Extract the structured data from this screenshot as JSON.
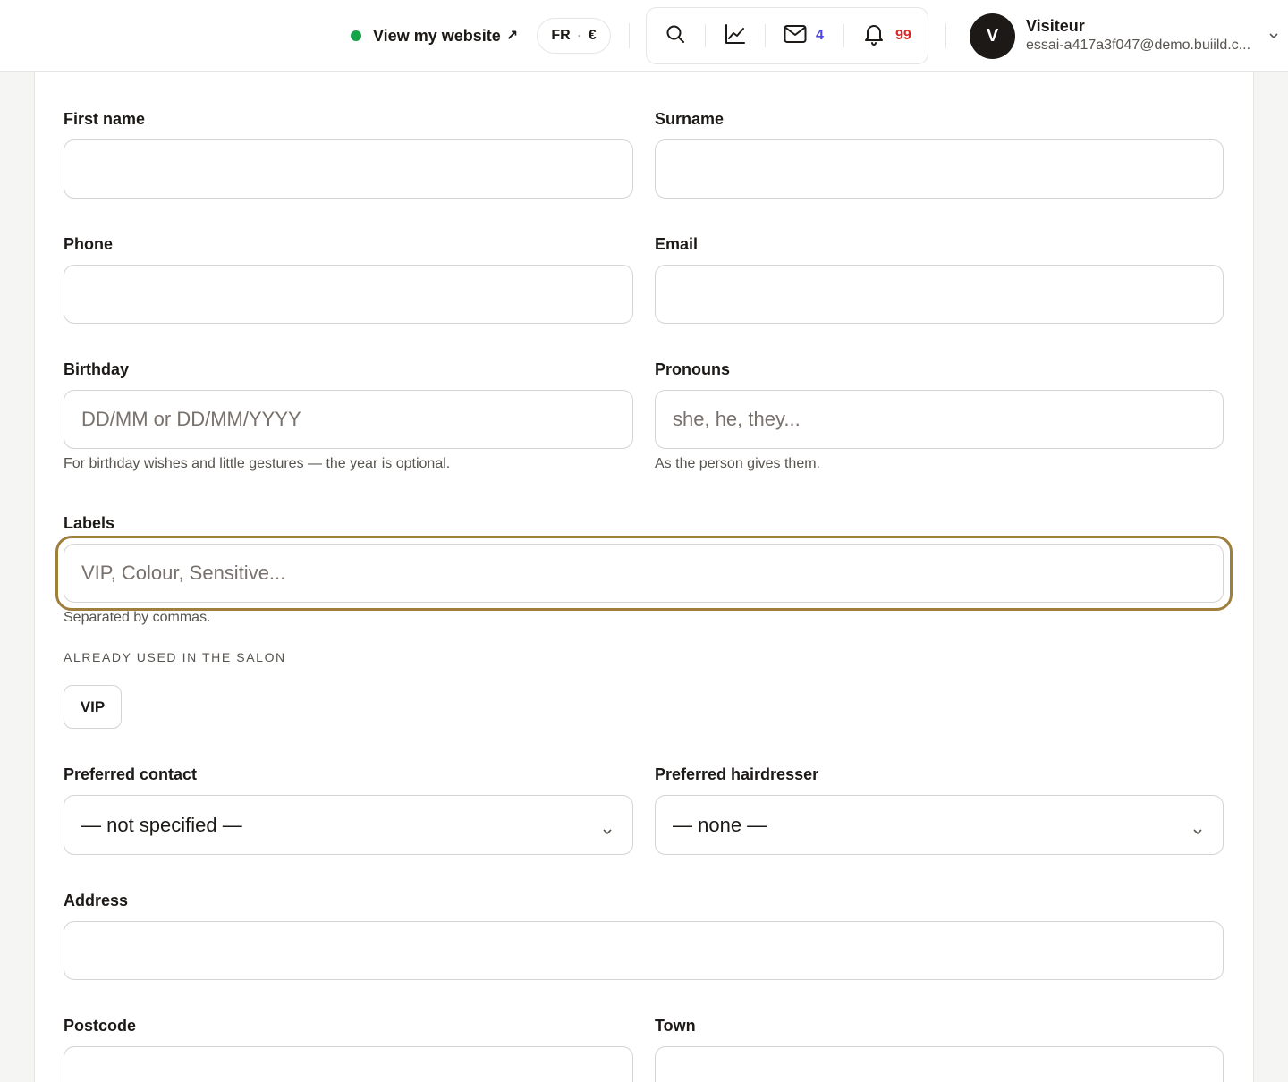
{
  "header": {
    "view_site_label": "View my website",
    "view_site_arrow": "↗",
    "locale": {
      "language": "FR",
      "separator": "·",
      "currency": "€"
    },
    "messages_count": "4",
    "notifications_count": "99",
    "user": {
      "initial": "V",
      "name": "Visiteur",
      "email": "essai-a417a3f047@demo.buiild.c..."
    }
  },
  "form": {
    "first_name": {
      "label": "First name",
      "value": "",
      "placeholder": ""
    },
    "surname": {
      "label": "Surname",
      "value": "",
      "placeholder": ""
    },
    "phone": {
      "label": "Phone",
      "value": "",
      "placeholder": ""
    },
    "email": {
      "label": "Email",
      "value": "",
      "placeholder": ""
    },
    "birthday": {
      "label": "Birthday",
      "value": "",
      "placeholder": "DD/MM or DD/MM/YYYY",
      "hint": "For birthday wishes and little gestures — the year is optional."
    },
    "pronouns": {
      "label": "Pronouns",
      "value": "",
      "placeholder": "she, he, they...",
      "hint": "As the person gives them."
    },
    "labels": {
      "label": "Labels",
      "value": "",
      "placeholder": "VIP, Colour, Sensitive...",
      "hint": "Separated by commas.",
      "used_caption": "Already used in the salon",
      "used": [
        "VIP"
      ]
    },
    "preferred_contact": {
      "label": "Preferred contact",
      "selected": "— not specified —"
    },
    "preferred_hairdresser": {
      "label": "Preferred hairdresser",
      "selected": "— none —"
    },
    "address": {
      "label": "Address",
      "value": "",
      "placeholder": ""
    },
    "postcode": {
      "label": "Postcode",
      "value": "",
      "placeholder": ""
    },
    "town": {
      "label": "Town",
      "value": "",
      "placeholder": ""
    }
  },
  "colors": {
    "accent_focus": "#a07f3c",
    "status_online": "#16a34a",
    "messages_badge": "#4f46e5",
    "notifications_badge": "#dc2626"
  }
}
